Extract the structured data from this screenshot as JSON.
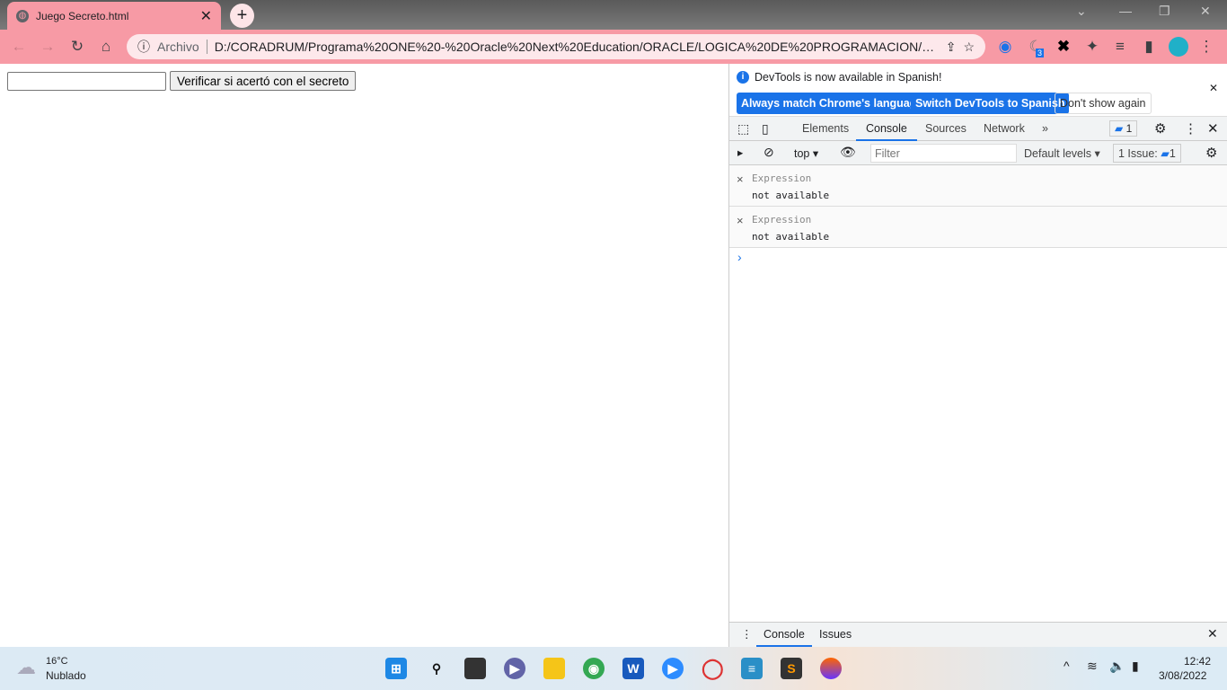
{
  "browser": {
    "tab_title": "Juego Secreto.html",
    "url_scheme": "Archivo",
    "url": "D:/CORADRUM/Programa%20ONE%20-%20Oracle%20Next%20Education/ORACLE/LOGICA%20DE%20PROGRAMACION/Jueg...",
    "extension_badge": "3",
    "accent": "#f79aa5"
  },
  "page": {
    "input_value": "",
    "verify_button": "Verificar si acertó con el secreto"
  },
  "devtools": {
    "info_text": "DevTools is now available in Spanish!",
    "btn_match": "Always match Chrome's language",
    "btn_switch": "Switch DevTools to Spanish",
    "btn_dont": "Don't show again",
    "tabs": [
      "Elements",
      "Console",
      "Sources",
      "Network"
    ],
    "active_tab": "Console",
    "issues_badge": "1",
    "context": "top",
    "filter_placeholder": "Filter",
    "levels": "Default levels",
    "issues_label": "1 Issue:",
    "issues_count": "1",
    "expressions": [
      {
        "label": "Expression",
        "value": "not available"
      },
      {
        "label": "Expression",
        "value": "not available"
      }
    ],
    "prompt": "›",
    "drawer_tabs": [
      "Console",
      "Issues"
    ]
  },
  "taskbar": {
    "temp": "16°C",
    "weather": "Nublado",
    "time": "12:42",
    "date": "3/08/2022"
  }
}
